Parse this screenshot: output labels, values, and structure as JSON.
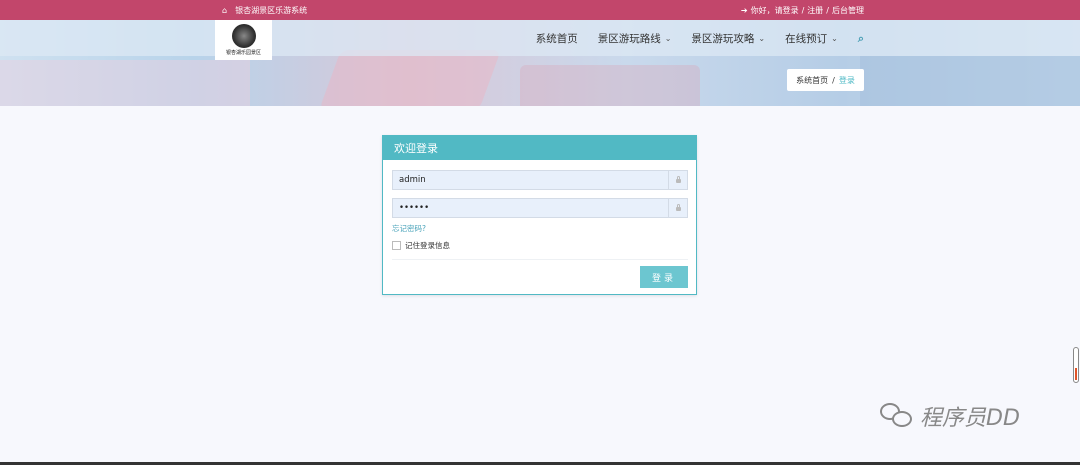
{
  "topbar": {
    "home_icon": "home-icon",
    "site_name": "银杏湖景区乐游系统",
    "login_icon": "sign-in-icon",
    "greeting": "你好，请登录",
    "sep1": "/",
    "register": "注册",
    "sep2": "/",
    "admin": "后台管理"
  },
  "header": {
    "logo_caption": "银杏湖乐园景区",
    "nav": [
      {
        "label": "系统首页"
      },
      {
        "label": "景区游玩路线"
      },
      {
        "label": "景区游玩攻略"
      },
      {
        "label": "在线预订"
      }
    ],
    "search_icon": "search-icon"
  },
  "breadcrumb": {
    "home": "系统首页",
    "sep": "/",
    "current": "登录"
  },
  "login": {
    "title": "欢迎登录",
    "username_value": "admin",
    "password_value": "••••••",
    "forgot": "忘记密码?",
    "remember": "记住登录信息",
    "submit": "登录"
  },
  "watermark": {
    "text": "程序员DD"
  },
  "colors": {
    "topbar": "#c2466b",
    "accent": "#51b9c4",
    "button": "#6cc6d0"
  }
}
